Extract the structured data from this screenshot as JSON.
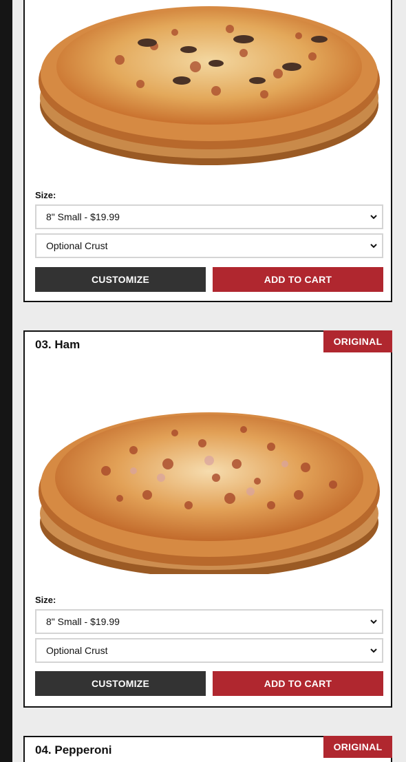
{
  "colors": {
    "accent_red": "#b0272f",
    "button_dark": "#333333",
    "page_bg": "#ececec",
    "card_border": "#111111"
  },
  "products": [
    {
      "badge": "",
      "title": "",
      "size_label": "Size:",
      "size_value": "8\" Small - $19.99",
      "crust_value": "Optional Crust",
      "customize_label": "CUSTOMIZE",
      "add_label": "ADD TO CART",
      "toppings_icon": "mushroom-pizza-image"
    },
    {
      "badge": "ORIGINAL",
      "title": "03. Ham",
      "size_label": "Size:",
      "size_value": "8\" Small - $19.99",
      "crust_value": "Optional Crust",
      "customize_label": "CUSTOMIZE",
      "add_label": "ADD TO CART",
      "toppings_icon": "ham-pizza-image"
    },
    {
      "badge": "ORIGINAL",
      "title": "04. Pepperoni"
    }
  ]
}
